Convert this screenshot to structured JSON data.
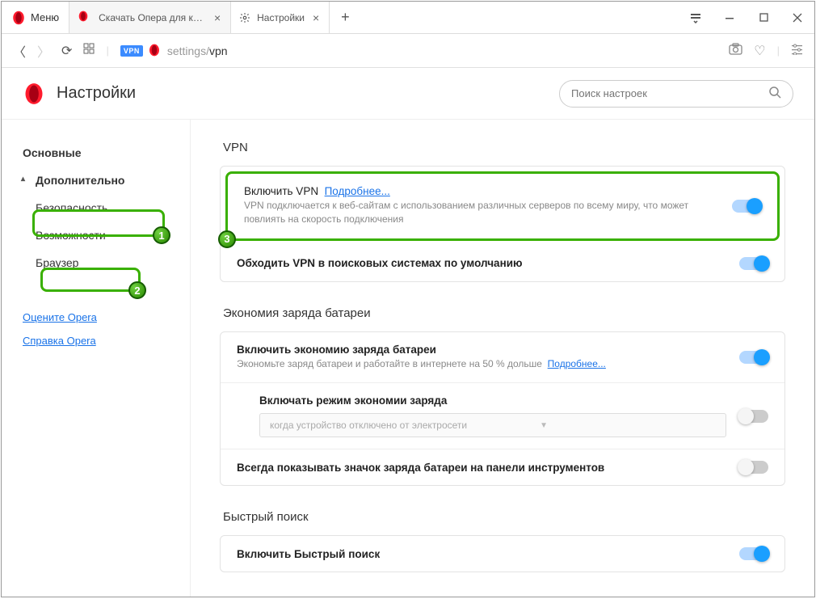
{
  "menu_label": "Меню",
  "tabs": [
    {
      "title": "Скачать Опера для компь",
      "closable": true
    },
    {
      "title": "Настройки",
      "closable": true
    }
  ],
  "url": {
    "prefix": "settings/",
    "suffix": "vpn",
    "vpn_badge": "VPN"
  },
  "page_title": "Настройки",
  "search": {
    "placeholder": "Поиск настроек"
  },
  "sidebar": {
    "basic": "Основные",
    "advanced": "Дополнительно",
    "security": "Безопасность",
    "features": "Возможности",
    "browser": "Браузер",
    "rate_link": "Оцените Opera",
    "help_link": "Справка Opera"
  },
  "sections": {
    "vpn": {
      "heading": "VPN",
      "enable_title": "Включить VPN",
      "learn_more": "Подробнее...",
      "enable_desc": "VPN подключается к веб-сайтам с использованием различных серверов по всему миру, что может повлиять на скорость подключения",
      "bypass_title": "Обходить VPN в поисковых системах по умолчанию"
    },
    "battery": {
      "heading": "Экономия заряда батареи",
      "enable_title": "Включить экономию заряда батареи",
      "enable_desc": "Экономьте заряд батареи и работайте в интернете на 50 % дольше",
      "learn_more": "Подробнее...",
      "enable_mode_title": "Включать режим экономии заряда",
      "dropdown_value": "когда устройство отключено от электросети",
      "always_icon_title": "Всегда показывать значок заряда батареи на панели инструментов"
    },
    "quick": {
      "heading": "Быстрый поиск",
      "enable_title": "Включить Быстрый поиск"
    }
  },
  "badges": {
    "one": "1",
    "two": "2",
    "three": "3"
  }
}
